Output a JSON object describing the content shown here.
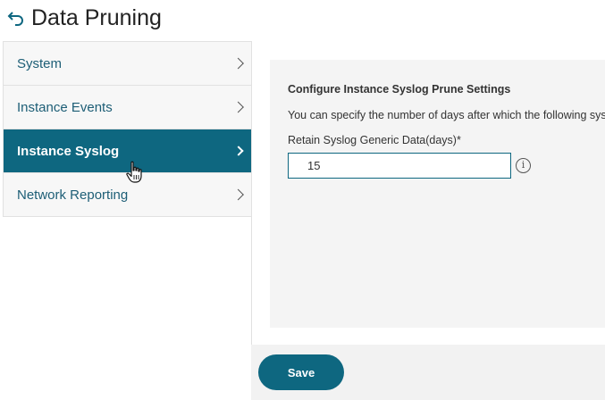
{
  "header": {
    "title": "Data Pruning",
    "back_icon": "back-arrow-icon"
  },
  "sidebar": {
    "items": [
      {
        "label": "System",
        "active": false
      },
      {
        "label": "Instance Events",
        "active": false
      },
      {
        "label": "Instance Syslog",
        "active": true
      },
      {
        "label": "Network Reporting",
        "active": false
      }
    ]
  },
  "main": {
    "heading": "Configure Instance Syslog Prune Settings",
    "description": "You can specify the number of days after which the following sys",
    "field": {
      "label": "Retain Syslog Generic Data(days)*",
      "value": "15"
    },
    "info_icon": "info-icon"
  },
  "footer": {
    "save_label": "Save"
  },
  "colors": {
    "accent": "#0e6780",
    "link_text": "#1d5e76",
    "sidebar_bg": "#f7f7f7",
    "card_bg": "#f4f4f4"
  }
}
